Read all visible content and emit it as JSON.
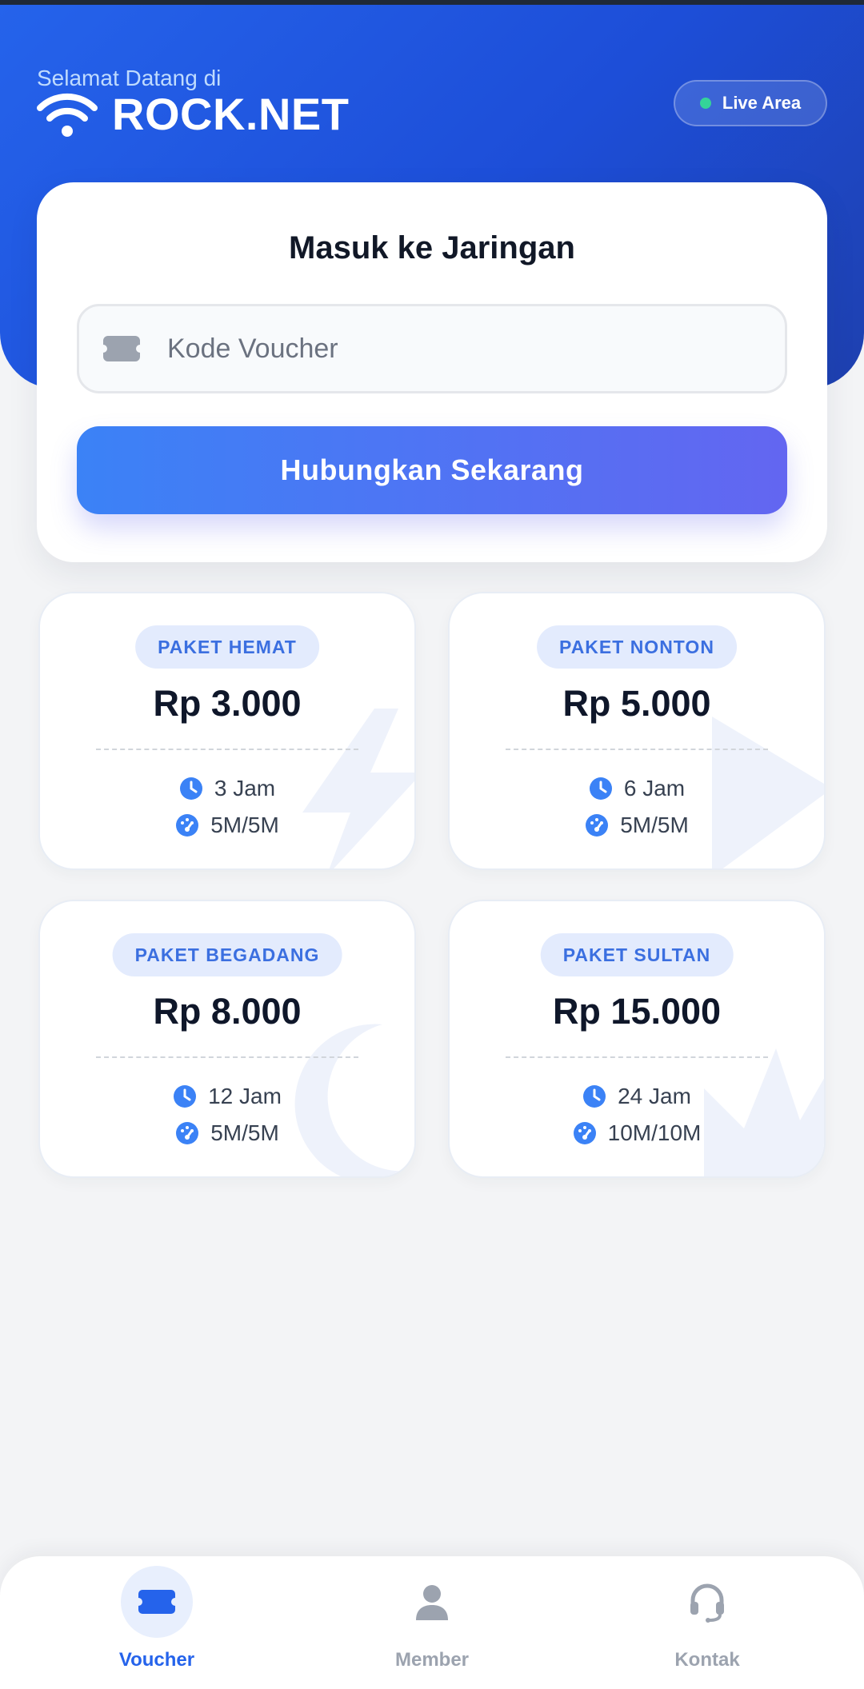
{
  "header": {
    "welcome": "Selamat Datang di",
    "brand": "ROCK.NET",
    "brand_icon": "wifi-icon",
    "live_label": "Live Area",
    "live_color": "#34d399",
    "accent": "#2563eb"
  },
  "login": {
    "title": "Masuk ke Jaringan",
    "voucher_placeholder": "Kode Voucher",
    "voucher_value": "",
    "connect_label": "Hubungkan Sekarang"
  },
  "packages": [
    {
      "label": "PAKET HEMAT",
      "price": "Rp 3.000",
      "duration": "3 Jam",
      "speed": "5M/5M",
      "decoration": "bolt-icon"
    },
    {
      "label": "PAKET NONTON",
      "price": "Rp 5.000",
      "duration": "6 Jam",
      "speed": "5M/5M",
      "decoration": "play-icon"
    },
    {
      "label": "PAKET BEGADANG",
      "price": "Rp 8.000",
      "duration": "12 Jam",
      "speed": "5M/5M",
      "decoration": "moon-icon"
    },
    {
      "label": "PAKET SULTAN",
      "price": "Rp 15.000",
      "duration": "24 Jam",
      "speed": "10M/10M",
      "decoration": "crown-icon"
    }
  ],
  "nav": [
    {
      "label": "Voucher",
      "icon": "ticket-icon",
      "active": true
    },
    {
      "label": "Member",
      "icon": "user-icon",
      "active": false
    },
    {
      "label": "Kontak",
      "icon": "headset-icon",
      "active": false
    }
  ]
}
